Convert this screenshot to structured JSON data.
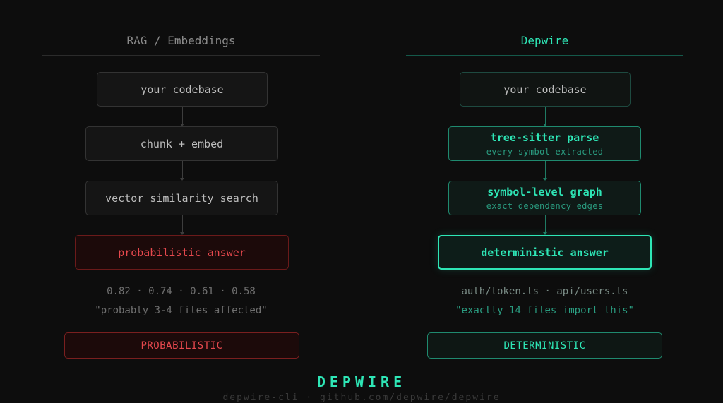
{
  "left": {
    "title": "RAG / Embeddings",
    "steps": [
      {
        "label": "your codebase"
      },
      {
        "label": "chunk + embed"
      },
      {
        "label": "vector similarity search"
      }
    ],
    "answer": "probabilistic answer",
    "scores": "0.82 · 0.74 · 0.61 · 0.58",
    "quote": "\"probably 3-4 files affected\"",
    "badge": "PROBABILISTIC"
  },
  "right": {
    "title": "Depwire",
    "steps": [
      {
        "label": "your codebase",
        "sub": ""
      },
      {
        "label": "tree-sitter parse",
        "sub": "every symbol extracted"
      },
      {
        "label": "symbol-level graph",
        "sub": "exact dependency edges"
      }
    ],
    "answer": "deterministic answer",
    "files": "auth/token.ts · api/users.ts",
    "quote": "\"exactly 14 files import this\"",
    "badge": "DETERMINISTIC"
  },
  "footer": {
    "brand": "DEPWIRE",
    "sub": "depwire-cli · github.com/depwire/depwire"
  },
  "colors": {
    "background": "#0d0d0d",
    "accent_teal": "#2ee6b6",
    "accent_red": "#e5484d"
  }
}
